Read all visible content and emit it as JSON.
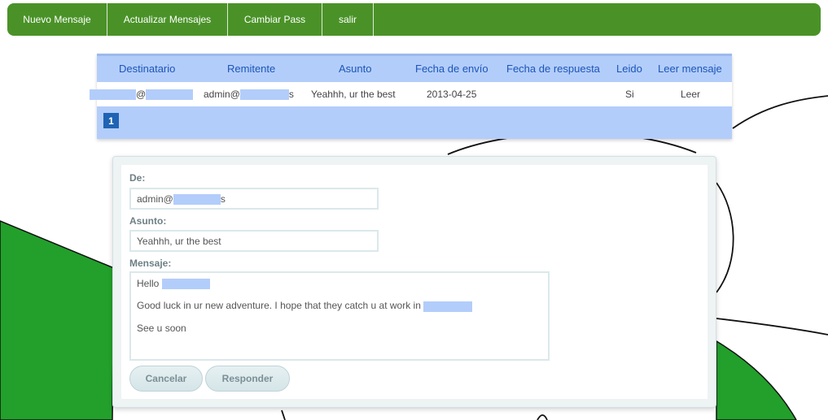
{
  "nav": {
    "items": [
      "Nuevo Mensaje",
      "Actualizar Mensajes",
      "Cambiar Pass",
      "salir"
    ]
  },
  "table": {
    "headers": [
      "Destinatario",
      "Remitente",
      "Asunto",
      "Fecha de envío",
      "Fecha de respuesta",
      "Leido",
      "Leer mensaje"
    ],
    "rows": [
      {
        "destinatario_sep": "@",
        "remitente_prefix": "admin@",
        "remitente_suffix": "s",
        "asunto": "Yeahhh, ur the best",
        "fecha_envio": "2013-04-25",
        "fecha_respuesta": "",
        "leido": "Si",
        "leer": "Leer"
      }
    ],
    "pagination": {
      "current_page": "1"
    }
  },
  "form": {
    "de_label": "De:",
    "de_prefix": "admin@",
    "de_suffix": "s",
    "asunto_label": "Asunto:",
    "asunto_value": "Yeahhh, ur the best",
    "mensaje_label": "Mensaje:",
    "mensaje_line1": "Hello",
    "mensaje_line2": "Good luck in ur new adventure. I hope that they catch u at work in",
    "mensaje_line3": "See u soon",
    "cancel_label": "Cancelar",
    "reply_label": "Responder"
  },
  "colors": {
    "nav_green": "#4a9228",
    "table_blue": "#b3cdfb",
    "header_text": "#1c56b5",
    "page_active": "#1f63b3",
    "background_green": "#22a02b"
  }
}
